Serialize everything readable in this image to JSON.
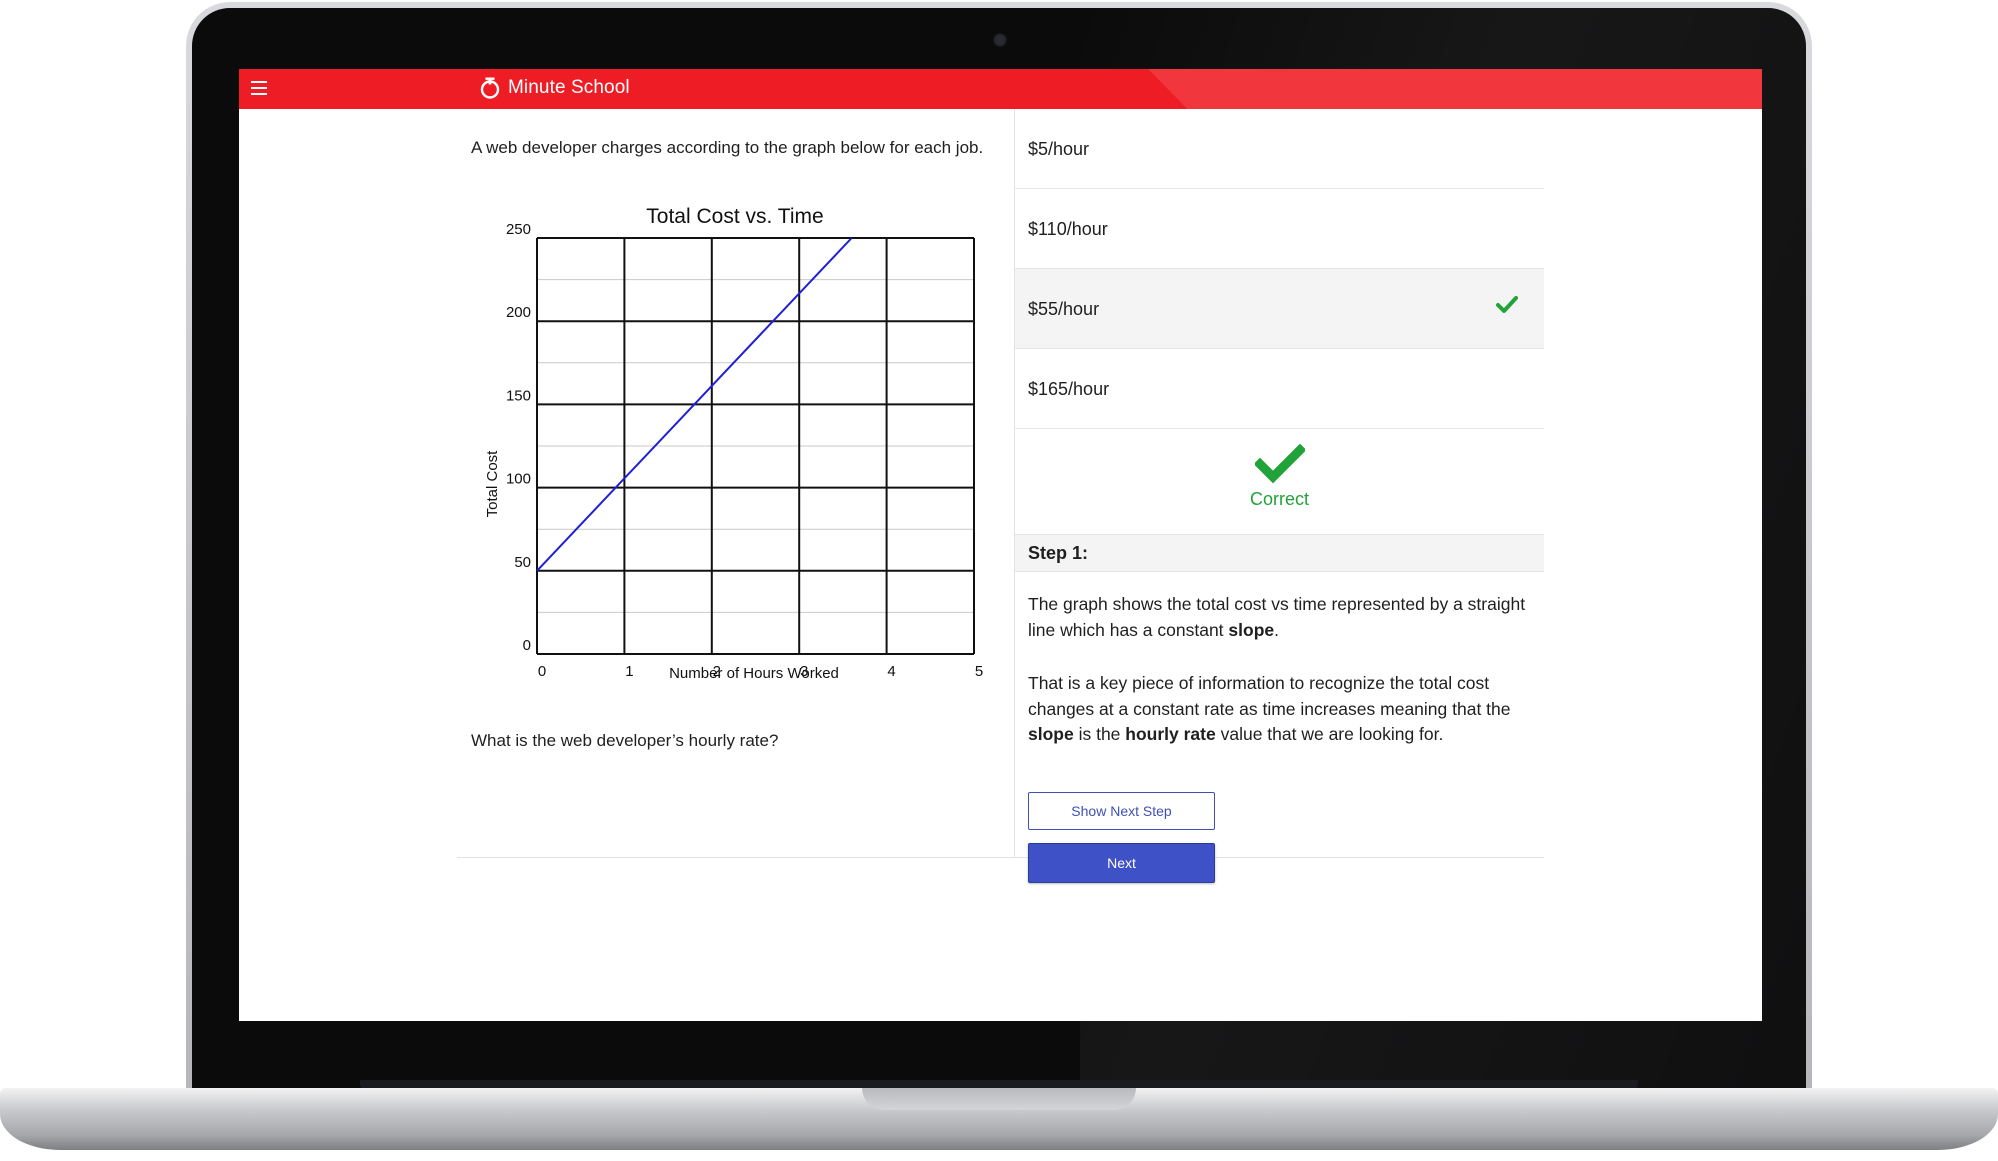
{
  "app": {
    "name": "Minute School",
    "brand_color": "#ee1c25",
    "menu_icon": "hamburger-menu-icon",
    "logo_icon": "power-timer-icon"
  },
  "question": {
    "intro": "A web developer charges according to the graph below for each job.",
    "prompt": "What is the web developer’s hourly rate?"
  },
  "chart_data": {
    "type": "line",
    "title": "Total Cost vs. Time",
    "xlabel": "Number of Hours Worked",
    "ylabel": "Total Cost",
    "xlim": [
      0,
      5
    ],
    "ylim": [
      0,
      250
    ],
    "x_ticks": [
      "0",
      "1",
      "2",
      "3",
      "4",
      "5"
    ],
    "y_ticks": [
      "0",
      "50",
      "100",
      "150",
      "200",
      "250"
    ],
    "grid": true,
    "series": [
      {
        "x": [
          0,
          3.6
        ],
        "y": [
          50,
          250
        ],
        "color": "#1f1fd6"
      }
    ]
  },
  "answers": {
    "options": [
      {
        "label": "$5/hour",
        "selected": false
      },
      {
        "label": "$110/hour",
        "selected": false
      },
      {
        "label": "$55/hour",
        "selected": true,
        "icon": "checkmark-icon"
      },
      {
        "label": "$165/hour",
        "selected": false
      }
    ],
    "result": {
      "label": "Correct",
      "icon": "checkmark-icon",
      "color": "#22a33a"
    }
  },
  "explanation": {
    "step_title": "Step 1:",
    "paragraph1": {
      "before": "The graph shows the total cost vs time represented by a straight line which has a constant ",
      "bold1": "slope",
      "after": "."
    },
    "paragraph2": {
      "before": "That is a key piece of information to recognize the total cost changes at a constant rate as time increases meaning that the ",
      "bold1": "slope",
      "middle": " is the ",
      "bold2": "hourly rate",
      "after": " value that we are looking for."
    }
  },
  "buttons": {
    "show_next_step": "Show Next Step",
    "next": "Next",
    "accent_color": "#3f51c7"
  }
}
